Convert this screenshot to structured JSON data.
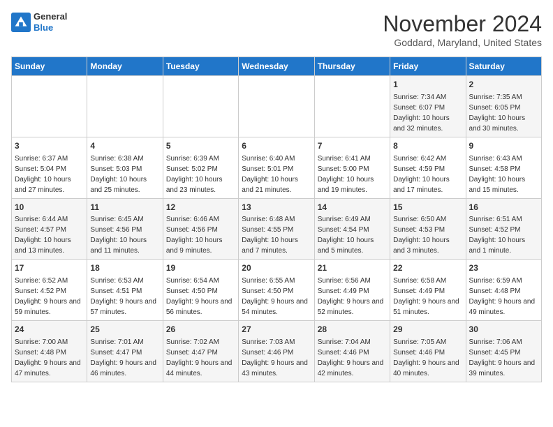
{
  "app": {
    "name": "GeneralBlue",
    "name_line1": "General",
    "name_line2": "Blue"
  },
  "header": {
    "month": "November 2024",
    "location": "Goddard, Maryland, United States"
  },
  "days_of_week": [
    "Sunday",
    "Monday",
    "Tuesday",
    "Wednesday",
    "Thursday",
    "Friday",
    "Saturday"
  ],
  "weeks": [
    [
      {
        "day": "",
        "info": ""
      },
      {
        "day": "",
        "info": ""
      },
      {
        "day": "",
        "info": ""
      },
      {
        "day": "",
        "info": ""
      },
      {
        "day": "",
        "info": ""
      },
      {
        "day": "1",
        "info": "Sunrise: 7:34 AM\nSunset: 6:07 PM\nDaylight: 10 hours and 32 minutes."
      },
      {
        "day": "2",
        "info": "Sunrise: 7:35 AM\nSunset: 6:05 PM\nDaylight: 10 hours and 30 minutes."
      }
    ],
    [
      {
        "day": "3",
        "info": "Sunrise: 6:37 AM\nSunset: 5:04 PM\nDaylight: 10 hours and 27 minutes."
      },
      {
        "day": "4",
        "info": "Sunrise: 6:38 AM\nSunset: 5:03 PM\nDaylight: 10 hours and 25 minutes."
      },
      {
        "day": "5",
        "info": "Sunrise: 6:39 AM\nSunset: 5:02 PM\nDaylight: 10 hours and 23 minutes."
      },
      {
        "day": "6",
        "info": "Sunrise: 6:40 AM\nSunset: 5:01 PM\nDaylight: 10 hours and 21 minutes."
      },
      {
        "day": "7",
        "info": "Sunrise: 6:41 AM\nSunset: 5:00 PM\nDaylight: 10 hours and 19 minutes."
      },
      {
        "day": "8",
        "info": "Sunrise: 6:42 AM\nSunset: 4:59 PM\nDaylight: 10 hours and 17 minutes."
      },
      {
        "day": "9",
        "info": "Sunrise: 6:43 AM\nSunset: 4:58 PM\nDaylight: 10 hours and 15 minutes."
      }
    ],
    [
      {
        "day": "10",
        "info": "Sunrise: 6:44 AM\nSunset: 4:57 PM\nDaylight: 10 hours and 13 minutes."
      },
      {
        "day": "11",
        "info": "Sunrise: 6:45 AM\nSunset: 4:56 PM\nDaylight: 10 hours and 11 minutes."
      },
      {
        "day": "12",
        "info": "Sunrise: 6:46 AM\nSunset: 4:56 PM\nDaylight: 10 hours and 9 minutes."
      },
      {
        "day": "13",
        "info": "Sunrise: 6:48 AM\nSunset: 4:55 PM\nDaylight: 10 hours and 7 minutes."
      },
      {
        "day": "14",
        "info": "Sunrise: 6:49 AM\nSunset: 4:54 PM\nDaylight: 10 hours and 5 minutes."
      },
      {
        "day": "15",
        "info": "Sunrise: 6:50 AM\nSunset: 4:53 PM\nDaylight: 10 hours and 3 minutes."
      },
      {
        "day": "16",
        "info": "Sunrise: 6:51 AM\nSunset: 4:52 PM\nDaylight: 10 hours and 1 minute."
      }
    ],
    [
      {
        "day": "17",
        "info": "Sunrise: 6:52 AM\nSunset: 4:52 PM\nDaylight: 9 hours and 59 minutes."
      },
      {
        "day": "18",
        "info": "Sunrise: 6:53 AM\nSunset: 4:51 PM\nDaylight: 9 hours and 57 minutes."
      },
      {
        "day": "19",
        "info": "Sunrise: 6:54 AM\nSunset: 4:50 PM\nDaylight: 9 hours and 56 minutes."
      },
      {
        "day": "20",
        "info": "Sunrise: 6:55 AM\nSunset: 4:50 PM\nDaylight: 9 hours and 54 minutes."
      },
      {
        "day": "21",
        "info": "Sunrise: 6:56 AM\nSunset: 4:49 PM\nDaylight: 9 hours and 52 minutes."
      },
      {
        "day": "22",
        "info": "Sunrise: 6:58 AM\nSunset: 4:49 PM\nDaylight: 9 hours and 51 minutes."
      },
      {
        "day": "23",
        "info": "Sunrise: 6:59 AM\nSunset: 4:48 PM\nDaylight: 9 hours and 49 minutes."
      }
    ],
    [
      {
        "day": "24",
        "info": "Sunrise: 7:00 AM\nSunset: 4:48 PM\nDaylight: 9 hours and 47 minutes."
      },
      {
        "day": "25",
        "info": "Sunrise: 7:01 AM\nSunset: 4:47 PM\nDaylight: 9 hours and 46 minutes."
      },
      {
        "day": "26",
        "info": "Sunrise: 7:02 AM\nSunset: 4:47 PM\nDaylight: 9 hours and 44 minutes."
      },
      {
        "day": "27",
        "info": "Sunrise: 7:03 AM\nSunset: 4:46 PM\nDaylight: 9 hours and 43 minutes."
      },
      {
        "day": "28",
        "info": "Sunrise: 7:04 AM\nSunset: 4:46 PM\nDaylight: 9 hours and 42 minutes."
      },
      {
        "day": "29",
        "info": "Sunrise: 7:05 AM\nSunset: 4:46 PM\nDaylight: 9 hours and 40 minutes."
      },
      {
        "day": "30",
        "info": "Sunrise: 7:06 AM\nSunset: 4:45 PM\nDaylight: 9 hours and 39 minutes."
      }
    ]
  ]
}
